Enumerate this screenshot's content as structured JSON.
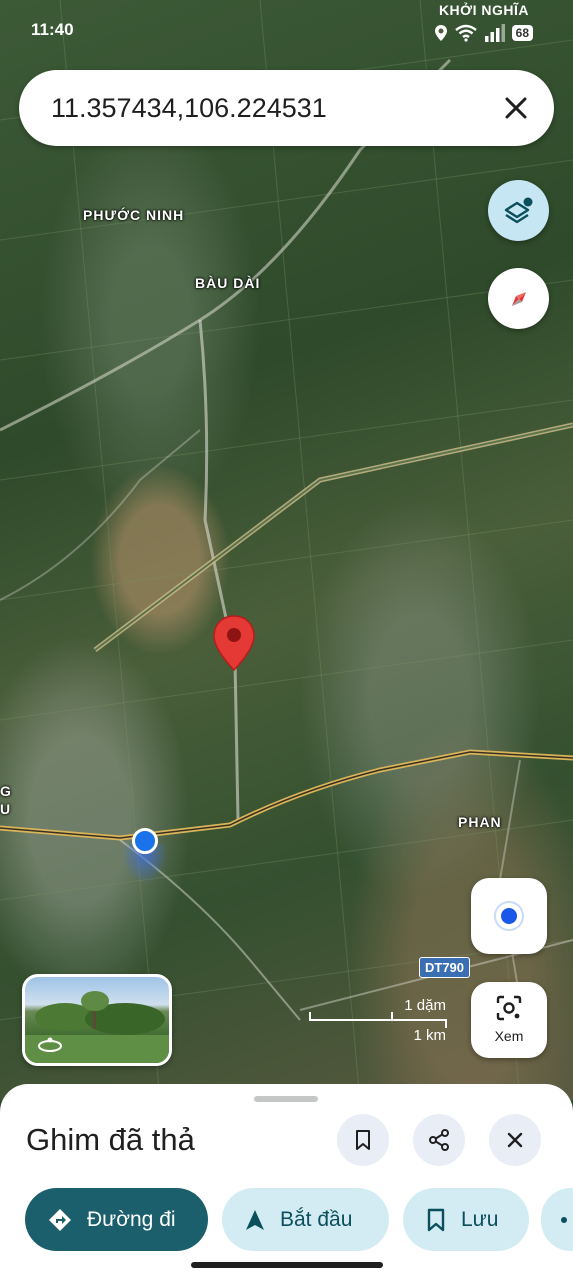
{
  "status_bar": {
    "time": "11:40",
    "carrier": "KHỞI NGHĨA",
    "battery": "68"
  },
  "search": {
    "value": "11.357434,106.224531"
  },
  "map_labels": {
    "phuoc_ninh": "PHƯỚC NINH",
    "bau_dai": "BÀU DÀI",
    "phan": "PHAN",
    "edge": "G\nU",
    "road_shield": "DT790"
  },
  "scale": {
    "imperial": "1 dặm",
    "metric": "1 km"
  },
  "lens": {
    "label": "Xem"
  },
  "sheet": {
    "title": "Ghim đã thả",
    "chips": {
      "directions": "Đường đi",
      "start": "Bắt đầu",
      "save": "Lưu"
    }
  },
  "colors": {
    "primary": "#1a5f6b",
    "secondary": "#d3ecf3",
    "pin": "#e53935",
    "location": "#1a73e8"
  },
  "icons": [
    "location-icon",
    "wifi-icon",
    "signal-icon",
    "close-icon",
    "layers-icon",
    "compass-icon",
    "my-location-icon",
    "lens-icon",
    "street-view-icon",
    "bookmark-icon",
    "share-icon",
    "directions-icon",
    "navigation-icon"
  ]
}
